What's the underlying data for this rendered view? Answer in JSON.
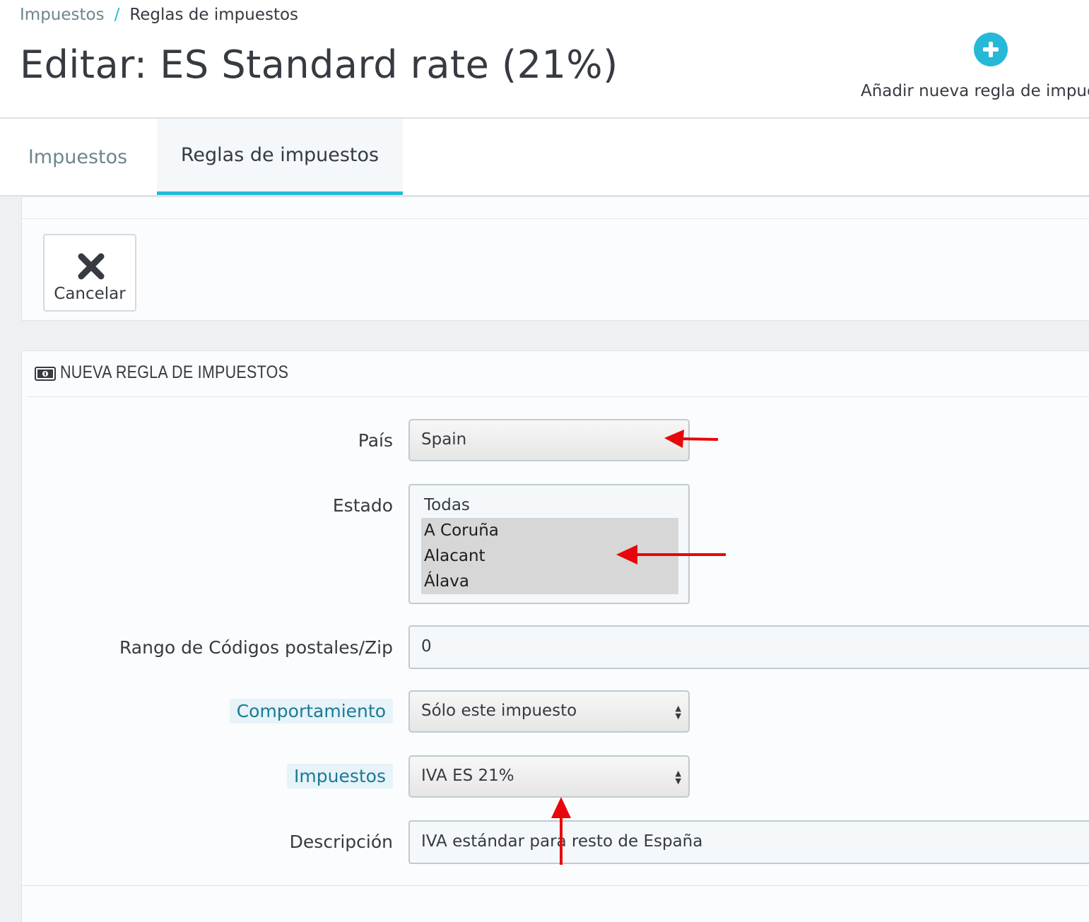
{
  "breadcrumb": {
    "parent": "Impuestos",
    "separator": "/",
    "current": "Reglas de impuestos"
  },
  "page_title": "Editar: ES Standard rate (21%)",
  "toolbar": {
    "add_rule_label": "Añadir nueva regla de impue"
  },
  "tabs": [
    {
      "label": "Impuestos",
      "active": false
    },
    {
      "label": "Reglas de impuestos",
      "active": true
    }
  ],
  "actions": {
    "cancel_label": "Cancelar"
  },
  "form": {
    "heading": "NUEVA REGLA DE IMPUESTOS",
    "country": {
      "label": "País",
      "value": "Spain"
    },
    "state": {
      "label": "Estado",
      "options": [
        {
          "label": "Todas",
          "selected": false
        },
        {
          "label": "A Coruña",
          "selected": true
        },
        {
          "label": "Alacant",
          "selected": true
        },
        {
          "label": "Álava",
          "selected": true
        }
      ]
    },
    "zip": {
      "label": "Rango de Códigos postales/Zip",
      "value": "0"
    },
    "behavior": {
      "label": "Comportamiento",
      "value": "Sólo este impuesto"
    },
    "tax": {
      "label": "Impuestos",
      "value": "IVA ES 21%"
    },
    "description": {
      "label": "Descripción",
      "value": "IVA estándar para resto de España"
    }
  },
  "colors": {
    "accent": "#25b9d7",
    "annotation_arrow": "#e8060c",
    "text": "#363a41",
    "muted": "#6c868e"
  }
}
